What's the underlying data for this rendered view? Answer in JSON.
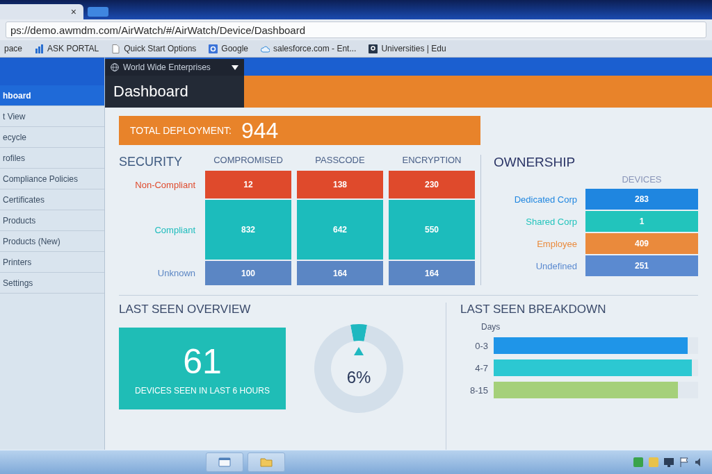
{
  "browser": {
    "tab": {
      "close": "×"
    },
    "address": "ps://demo.awmdm.com/AirWatch/#/AirWatch/Device/Dashboard",
    "bookmarks": [
      {
        "label": "pace",
        "kind": "text"
      },
      {
        "label": "ASK PORTAL",
        "kind": "app"
      },
      {
        "label": "Quick Start Options",
        "kind": "page"
      },
      {
        "label": "Google",
        "kind": "tile"
      },
      {
        "label": "salesforce.com - Ent...",
        "kind": "cloud"
      },
      {
        "label": "Universities | Edu",
        "kind": "tile-dark"
      }
    ]
  },
  "org_selector": {
    "label": "World Wide Enterprises"
  },
  "page_title": "Dashboard",
  "sidebar": {
    "items": [
      {
        "label": "hboard",
        "selected": true
      },
      {
        "label": "t View",
        "selected": false
      },
      {
        "label": "ecycle",
        "selected": false
      },
      {
        "label": "rofiles",
        "selected": false
      },
      {
        "label": "Compliance Policies",
        "selected": false
      },
      {
        "label": "Certificates",
        "selected": false
      },
      {
        "label": "Products",
        "selected": false
      },
      {
        "label": "Products (New)",
        "selected": false
      },
      {
        "label": "Printers",
        "selected": false
      },
      {
        "label": "Settings",
        "selected": false
      }
    ]
  },
  "total_deployment": {
    "label": "TOTAL DEPLOYMENT:",
    "value": "944"
  },
  "security": {
    "title": "SECURITY",
    "rows": [
      {
        "label": "Non-Compliant",
        "color": "#df4a2c"
      },
      {
        "label": "Compliant",
        "color": "#1cbcbc"
      },
      {
        "label": "Unknown",
        "color": "#5b86c4"
      }
    ],
    "columns": [
      {
        "title": "COMPROMISED",
        "values": [
          "12",
          "832",
          "100"
        ]
      },
      {
        "title": "PASSCODE",
        "values": [
          "138",
          "642",
          "164"
        ]
      },
      {
        "title": "ENCRYPTION",
        "values": [
          "230",
          "550",
          "164"
        ]
      }
    ]
  },
  "ownership": {
    "title": "OWNERSHIP",
    "column": "DEVICES",
    "rows": [
      {
        "label": "Dedicated Corp",
        "value": "283",
        "color": "#1f86e0"
      },
      {
        "label": "Shared Corp",
        "value": "1",
        "color": "#22c4bc"
      },
      {
        "label": "Employee",
        "value": "409",
        "color": "#ea8a3c"
      },
      {
        "label": "Undefined",
        "value": "251",
        "color": "#5b8ad0"
      }
    ]
  },
  "last_seen_overview": {
    "title": "LAST SEEN OVERVIEW",
    "count": "61",
    "caption": "DEVICES SEEN IN LAST 6 HOURS",
    "percent": "6%",
    "chart_data": {
      "type": "donut",
      "values": [
        6,
        94
      ]
    }
  },
  "last_seen_breakdown": {
    "title": "LAST SEEN BREAKDOWN",
    "axis_label": "Days",
    "bars": [
      {
        "label": "0-3",
        "level": 0.95,
        "color": "#1f95e8"
      },
      {
        "label": "4-7",
        "level": 0.97,
        "color": "#2cc8d2"
      },
      {
        "label": "8-15",
        "level": 0.9,
        "color": "#a5d07a"
      }
    ]
  }
}
